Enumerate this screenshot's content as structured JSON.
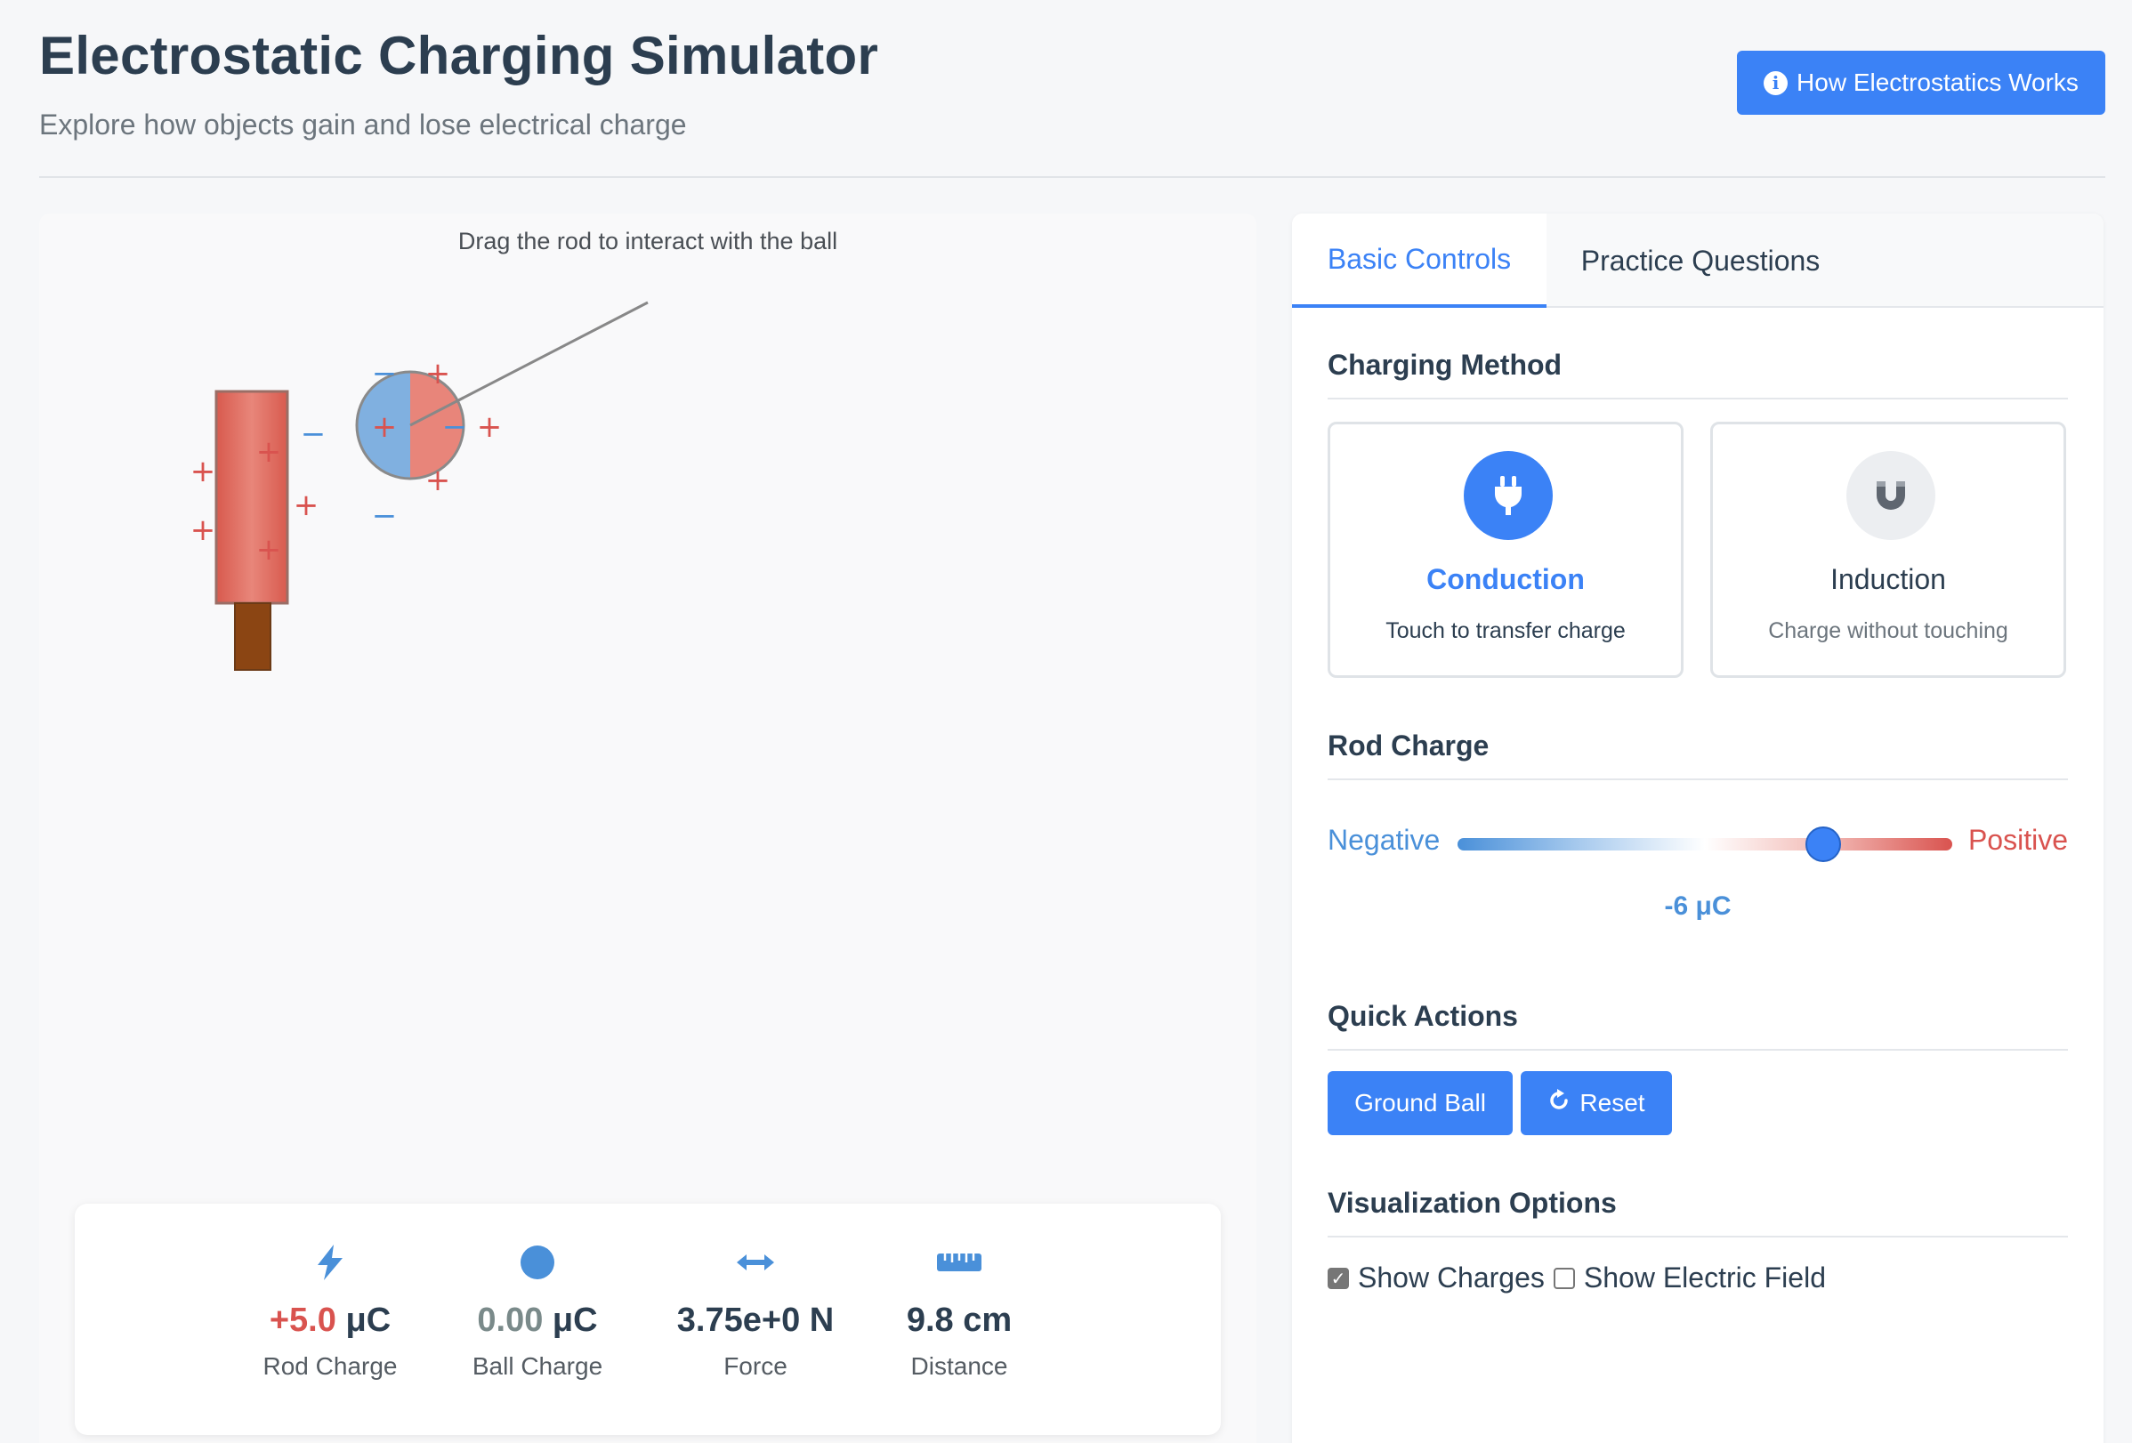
{
  "header": {
    "title": "Electrostatic Charging Simulator",
    "subtitle": "Explore how objects gain and lose electrical charge",
    "help_button": "How Electrostatics Works",
    "help_icon": "info-icon"
  },
  "simulation": {
    "hint": "Drag the rod to interact with the ball",
    "charge_symbols": {
      "positive": "+",
      "negative": "−"
    },
    "colors": {
      "positive": "#d9534f",
      "negative": "#4a90d9",
      "rod": "#e06a5e",
      "handle": "#8b4513"
    }
  },
  "stats": [
    {
      "icon": "lightning-bolt-icon",
      "value": "+5.0",
      "unit": " μC",
      "label": "Rod Charge"
    },
    {
      "icon": "circle-icon",
      "value": "0.00",
      "unit": " μC",
      "label": "Ball Charge"
    },
    {
      "icon": "left-right-arrow-icon",
      "value": "3.75e+0 N",
      "unit": "",
      "label": "Force"
    },
    {
      "icon": "ruler-icon",
      "value": "9.8 cm",
      "unit": "",
      "label": "Distance"
    }
  ],
  "tabs": [
    {
      "label": "Basic Controls",
      "active": true
    },
    {
      "label": "Practice Questions",
      "active": false
    }
  ],
  "charging_method": {
    "title": "Charging Method",
    "options": [
      {
        "name": "Conduction",
        "desc": "Touch to transfer charge",
        "icon": "plug-icon",
        "selected": true
      },
      {
        "name": "Induction",
        "desc": "Charge without touching",
        "icon": "magnet-icon",
        "selected": false
      }
    ]
  },
  "rod_charge": {
    "title": "Rod Charge",
    "min_label": "Negative",
    "max_label": "Positive",
    "value_label": "-6 μC",
    "slider_fraction": 0.74
  },
  "quick_actions": {
    "title": "Quick Actions",
    "ground_label": "Ground Ball",
    "reset_label": "Reset",
    "reset_icon": "rotate-icon"
  },
  "visualization": {
    "title": "Visualization Options",
    "show_charges": {
      "label": "Show Charges",
      "checked": true
    },
    "show_field": {
      "label": "Show Electric Field",
      "checked": false
    }
  },
  "accent_color": "#3b82f6"
}
